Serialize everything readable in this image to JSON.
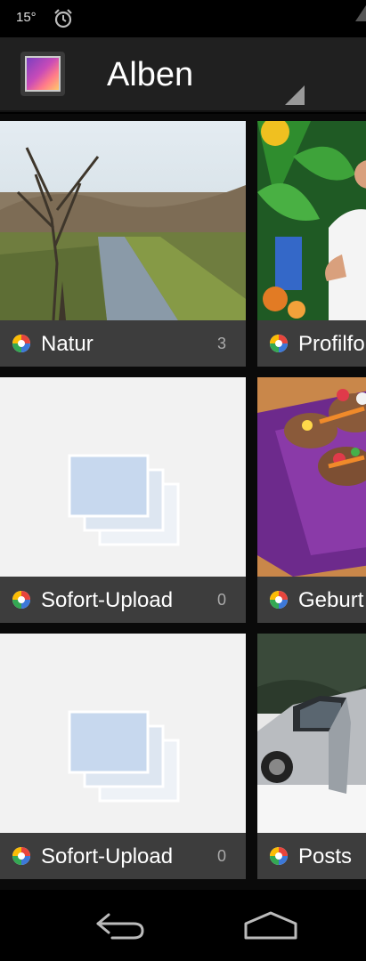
{
  "status_bar": {
    "temperature": "15°",
    "alarm_icon": "alarm-clock-icon"
  },
  "action_bar": {
    "app_icon": "gallery-app-icon",
    "title": "Alben"
  },
  "albums": [
    {
      "label": "Natur",
      "count": "3",
      "thumb": "photo-nature-river"
    },
    {
      "label": "Profilfo",
      "count": "",
      "thumb": "photo-person-garden"
    },
    {
      "label": "Sofort-Upload",
      "count": "0",
      "thumb": "placeholder-stack-icon"
    },
    {
      "label": "Geburt",
      "count": "",
      "thumb": "photo-food-tray"
    },
    {
      "label": "Sofort-Upload",
      "count": "0",
      "thumb": "placeholder-stack-icon"
    },
    {
      "label": "Posts",
      "count": "",
      "thumb": "photo-silver-car"
    }
  ],
  "nav_bar": {
    "back_icon": "back-arrow-icon",
    "home_icon": "home-icon"
  },
  "colors": {
    "action_bar_bg": "#202020",
    "caption_bg": "#3d3d3d",
    "placeholder_bg": "#f2f2f2",
    "placeholder_frame": "#c7d8ee"
  }
}
